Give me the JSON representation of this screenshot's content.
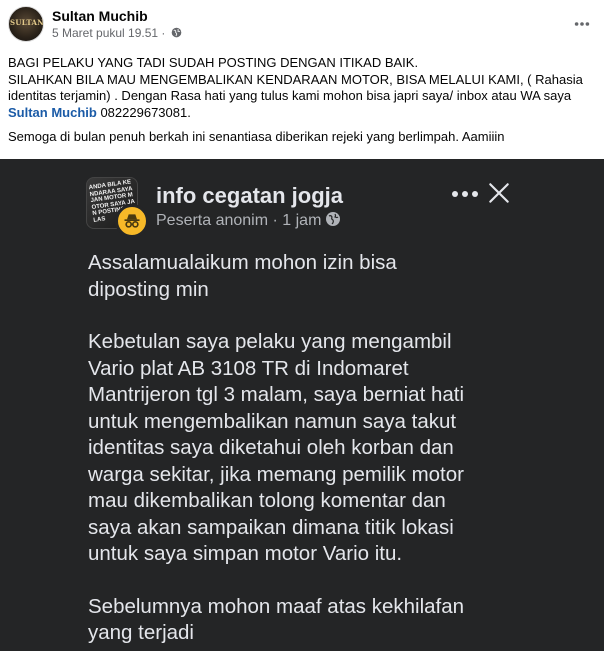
{
  "post": {
    "author": "Sultan Muchib",
    "avatar_text": "SULTAN",
    "time": "5 Maret pukul 19.51",
    "time_separator": " · ",
    "more_icon": "more-horizontal-icon",
    "line1": "BAGI PELAKU YANG TADI SUDAH POSTING DENGAN ITIKAD BAIK.",
    "line2": "SILAHKAN BILA MAU MENGEMBALIKAN KENDARAAN MOTOR, BISA MELALUI KAMI, ( Rahasia identitas terjamin) . Dengan Rasa hati yang tulus kami mohon bisa japri saya/ inbox atau WA  saya",
    "mention": "Sultan Muchib",
    "phone": " 082229673081.",
    "line3": "Semoga di bulan penuh berkah ini senantiasa diberikan rejeki yang berlimpah. Aamiiin"
  },
  "screenshot": {
    "thumb_text": "ANDA BILA KENDARAA SAYA JAN MOTOR MOTOR SAYA JAN POSTING LOLAS",
    "group_name": "info cegatan jogja",
    "author_label": "Peserta anonim",
    "separator": " · ",
    "time": "1 jam",
    "para1": "Assalamualaikum mohon izin bisa\ndiposting min",
    "para2": "Kebetulan saya pelaku yang mengambil\nVario plat AB 3108 TR di Indomaret\nMantrijeron tgl 3 malam, saya berniat hati\nuntuk mengembalikan namun saya takut\nidentitas saya diketahui oleh korban dan\nwarga sekitar, jika memang pemilik motor\nmau dikembalikan tolong komentar dan\nsaya akan sampaikan dimana titik lokasi\nuntuk saya simpan motor Vario itu.",
    "para3": "Sebelumnya mohon maaf atas kekhilafan\nyang terjadi"
  },
  "colors": {
    "link": "#1b5ba7",
    "dark_bg": "#242526",
    "dark_text": "#e4e6eb",
    "muted": "#b0b3b8",
    "anon_badge": "#f7b928"
  }
}
